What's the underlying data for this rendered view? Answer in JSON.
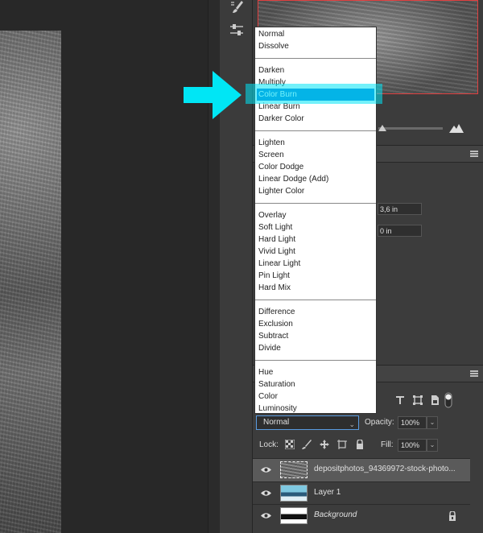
{
  "blend_modes": {
    "groups": [
      [
        "Normal",
        "Dissolve"
      ],
      [
        "Darken",
        "Multiply",
        "Color Burn",
        "Linear Burn",
        "Darker Color"
      ],
      [
        "Lighten",
        "Screen",
        "Color Dodge",
        "Linear Dodge (Add)",
        "Lighter Color"
      ],
      [
        "Overlay",
        "Soft Light",
        "Hard Light",
        "Vivid Light",
        "Linear Light",
        "Pin Light",
        "Hard Mix"
      ],
      [
        "Difference",
        "Exclusion",
        "Subtract",
        "Divide"
      ],
      [
        "Hue",
        "Saturation",
        "Color",
        "Luminosity"
      ]
    ],
    "selected": "Color Burn"
  },
  "properties": {
    "field1_value": "3,6 in",
    "field2_value": "0 in"
  },
  "layers_panel": {
    "blend_mode_value": "Normal",
    "opacity_label": "Opacity:",
    "opacity_value": "100%",
    "lock_label": "Lock:",
    "fill_label": "Fill:",
    "fill_value": "100%",
    "layers": [
      {
        "name": "depositphotos_94369972-stock-photo...",
        "active": true
      },
      {
        "name": "Layer 1",
        "active": false
      },
      {
        "name": "Background",
        "active": false,
        "locked": true
      }
    ]
  },
  "colors": {
    "highlight_cyan": "#00e6f5",
    "selection_blue": "#0a79d6",
    "navigator_frame": "#e04040"
  }
}
